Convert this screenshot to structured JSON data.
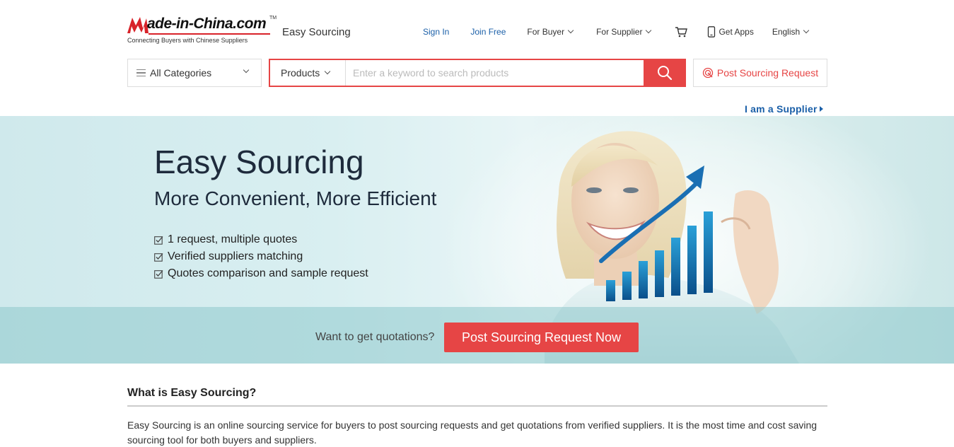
{
  "header": {
    "logo": {
      "text_prefix": "M",
      "text_main": "ade-in-China.com",
      "tm": "TM",
      "tagline": "Connecting Buyers with Chinese Suppliers"
    },
    "section_title": "Easy Sourcing",
    "nav": {
      "sign_in": "Sign In",
      "join_free": "Join Free",
      "for_buyer": "For Buyer",
      "for_supplier": "For Supplier",
      "get_apps": "Get Apps",
      "language": "English"
    }
  },
  "search": {
    "category": "All Categories",
    "type": "Products",
    "placeholder": "Enter a keyword to search products",
    "post_request": "Post Sourcing Request"
  },
  "supplier_link": "I am a Supplier",
  "banner": {
    "title": "Easy Sourcing",
    "subtitle": "More Convenient, More Efficient",
    "features": [
      "1 request, multiple quotes",
      "Verified suppliers matching",
      "Quotes comparison and sample request"
    ],
    "cta_text": "Want to get quotations?",
    "cta_button": "Post Sourcing Request Now"
  },
  "about": {
    "title": "What is Easy Sourcing?",
    "body": "Easy Sourcing is an online sourcing service for buyers to post sourcing requests and get quotations from verified suppliers. It is the most time and cost saving sourcing tool for both buyers and suppliers."
  },
  "colors": {
    "accent": "#e64545",
    "link": "#1a5fa8"
  }
}
